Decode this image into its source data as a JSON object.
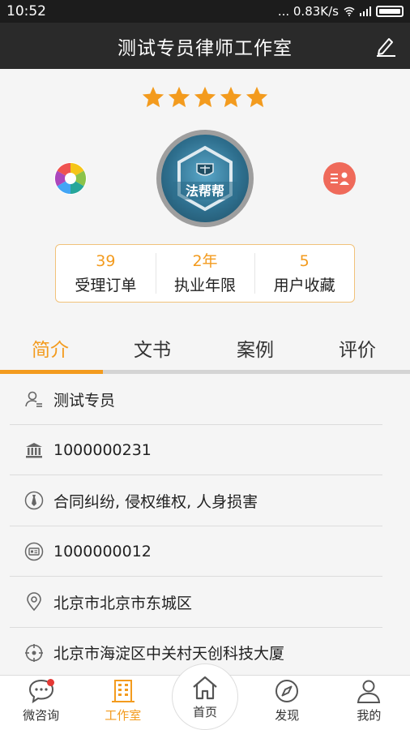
{
  "status_bar": {
    "time": "10:52",
    "speed": "... 0.83K/s"
  },
  "header": {
    "title": "测试专员律师工作室"
  },
  "rating": {
    "stars": 5
  },
  "avatar": {
    "logo_text": "法帮帮"
  },
  "stats": [
    {
      "value": "39",
      "label": "受理订单"
    },
    {
      "value": "2年",
      "label": "执业年限"
    },
    {
      "value": "5",
      "label": "用户收藏"
    }
  ],
  "tabs": [
    {
      "label": "简介",
      "active": true
    },
    {
      "label": "文书",
      "active": false
    },
    {
      "label": "案例",
      "active": false
    },
    {
      "label": "评价",
      "active": false
    }
  ],
  "info_rows": [
    {
      "icon": "person-icon",
      "text": "测试专员"
    },
    {
      "icon": "institution-icon",
      "text": "1000000231"
    },
    {
      "icon": "tie-icon",
      "text": "合同纠纷, 侵权维权, 人身损害"
    },
    {
      "icon": "id-card-icon",
      "text": "1000000012"
    },
    {
      "icon": "location-pin-icon",
      "text": "北京市北京市东城区"
    },
    {
      "icon": "crosshair-icon",
      "text": "北京市海淀区中关村天创科技大厦"
    }
  ],
  "bottom_nav": [
    {
      "label": "微咨询",
      "icon": "chat-icon",
      "badge": true
    },
    {
      "label": "工作室",
      "icon": "building-icon",
      "active": true
    },
    {
      "label": "首页",
      "icon": "home-icon"
    },
    {
      "label": "发现",
      "icon": "compass-icon"
    },
    {
      "label": "我的",
      "icon": "user-icon"
    }
  ],
  "colors": {
    "accent": "#f39b1e",
    "titlebar": "#2a2a2a",
    "statusbar": "#1c1c1c"
  }
}
